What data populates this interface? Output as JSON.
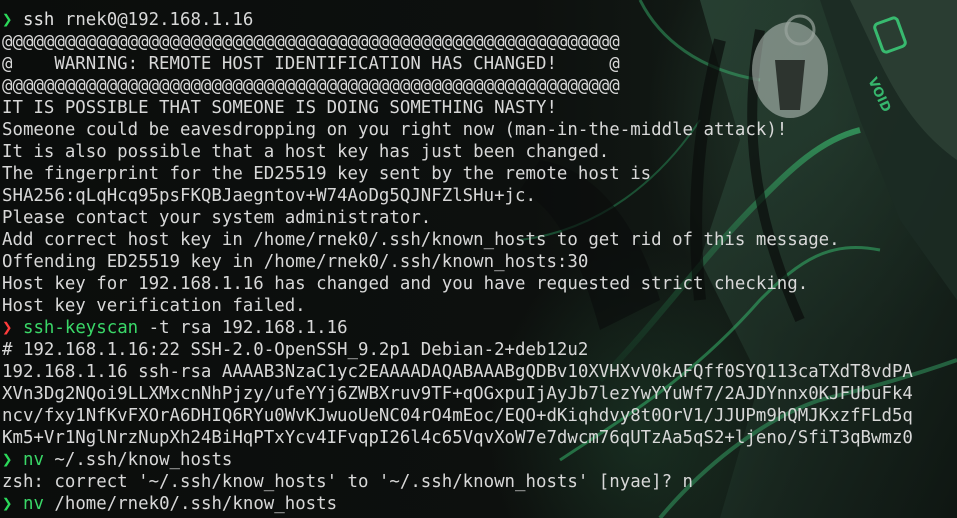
{
  "theme": {
    "foreground": "#d8d8d8",
    "prompt_ok": "#2bd95a",
    "prompt_err": "#ff3b3b",
    "command_highlight": "#3ad868",
    "background": "#0c0f0d"
  },
  "wallpaper": {
    "description_icon": "anime-character-icon",
    "text": "VOID"
  },
  "terminal": {
    "prompt_symbol": "❯",
    "lines": [
      {
        "type": "prompt",
        "status": "ok",
        "cmd": "ssh",
        "args": " rnek0@192.168.1.16"
      },
      {
        "type": "output",
        "text": "@@@@@@@@@@@@@@@@@@@@@@@@@@@@@@@@@@@@@@@@@@@@@@@@@@@@@@@@@@@"
      },
      {
        "type": "output",
        "text": "@    WARNING: REMOTE HOST IDENTIFICATION HAS CHANGED!     @"
      },
      {
        "type": "output",
        "text": "@@@@@@@@@@@@@@@@@@@@@@@@@@@@@@@@@@@@@@@@@@@@@@@@@@@@@@@@@@@"
      },
      {
        "type": "output",
        "text": "IT IS POSSIBLE THAT SOMEONE IS DOING SOMETHING NASTY!"
      },
      {
        "type": "output",
        "text": "Someone could be eavesdropping on you right now (man-in-the-middle attack)!"
      },
      {
        "type": "output",
        "text": "It is also possible that a host key has just been changed."
      },
      {
        "type": "output",
        "text": "The fingerprint for the ED25519 key sent by the remote host is"
      },
      {
        "type": "output",
        "text": "SHA256:qLqHcq95psFKQBJaegntov+W74AoDg5QJNFZlSHu+jc."
      },
      {
        "type": "output",
        "text": "Please contact your system administrator."
      },
      {
        "type": "output",
        "text": "Add correct host key in /home/rnek0/.ssh/known_hosts to get rid of this message."
      },
      {
        "type": "output",
        "text": "Offending ED25519 key in /home/rnek0/.ssh/known_hosts:30"
      },
      {
        "type": "output",
        "text": "Host key for 192.168.1.16 has changed and you have requested strict checking."
      },
      {
        "type": "output",
        "text": "Host key verification failed."
      },
      {
        "type": "prompt",
        "status": "err",
        "cmd": "ssh-keyscan",
        "args": " -t rsa 192.168.1.16"
      },
      {
        "type": "output",
        "text": "# 192.168.1.16:22 SSH-2.0-OpenSSH_9.2p1 Debian-2+deb12u2"
      },
      {
        "type": "output",
        "text": "192.168.1.16 ssh-rsa AAAAB3NzaC1yc2EAAAADAQABAAABgQDBv10XVHXvV0kAFQff0SYQ113caTXdT8vdPA"
      },
      {
        "type": "output",
        "text": "XVn3Dg2NQoi9LLXMxcnNhPjzy/ufeYYj6ZWBXruv9TF+qOGxpuIjAyJb7lezYwYYuWf7/2AJDYnnx0KJFUbuFk4"
      },
      {
        "type": "output",
        "text": "ncv/fxy1NfKvFXOrA6DHIQ6RYu0WvKJwuoUeNC04rO4mEoc/EQO+dKiqhdvy8t0OrV1/JJUPm9hQMJKxzfFLd5q"
      },
      {
        "type": "output",
        "text": "Km5+Vr1NglNrzNupXh24BiHqPTxYcv4IFvqpI26l4c65VqvXoW7e7dwcm76qUTzAa5qS2+ljeno/SfiT3qBwmz0"
      },
      {
        "type": "prompt",
        "status": "ok",
        "cmd": "nv",
        "args": " ~/.ssh/know_hosts"
      },
      {
        "type": "output",
        "text": "zsh: correct '~/.ssh/know_hosts' to '~/.ssh/known_hosts' [nyae]? n"
      },
      {
        "type": "prompt",
        "status": "ok",
        "cmd": "nv",
        "args": " /home/rnek0/.ssh/know_hosts"
      }
    ]
  }
}
